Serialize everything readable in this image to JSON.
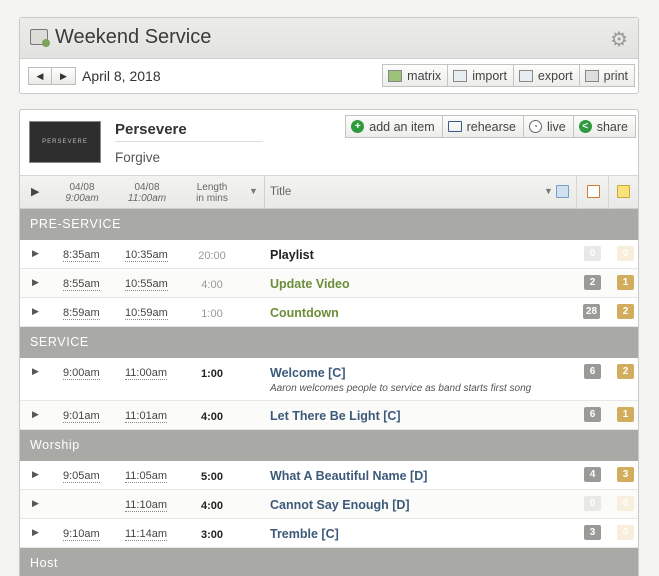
{
  "service": {
    "title": "Weekend Service",
    "date": "April 8, 2018",
    "tools": [
      "matrix",
      "import",
      "export",
      "print"
    ]
  },
  "plan": {
    "series_title": "Persevere",
    "series_subtitle": "Forgive",
    "image_text": "PERSEVERE",
    "actions": [
      "add an item",
      "rehearse",
      "live",
      "share"
    ]
  },
  "columns": {
    "time1_date": "04/08",
    "time1_time": "9:00am",
    "time2_date": "04/08",
    "time2_time": "11:00am",
    "length_l1": "Length",
    "length_l2": "in mins",
    "title": "Title"
  },
  "sections": [
    {
      "name": "PRE-SERVICE",
      "items": [
        {
          "t1": "8:35am",
          "t2": "10:35am",
          "len": "20:00",
          "len_bold": false,
          "title": "Playlist",
          "color": "black",
          "c1": "0",
          "c2": "0",
          "c1_dim": true,
          "c2_dim": true
        },
        {
          "t1": "8:55am",
          "t2": "10:55am",
          "len": "4:00",
          "len_bold": false,
          "title": "Update Video",
          "color": "green",
          "c1": "2",
          "c2": "1"
        },
        {
          "t1": "8:59am",
          "t2": "10:59am",
          "len": "1:00",
          "len_bold": false,
          "title": "Countdown",
          "color": "green",
          "c1": "28",
          "c2": "2"
        }
      ]
    },
    {
      "name": "SERVICE",
      "items": [
        {
          "t1": "9:00am",
          "t2": "11:00am",
          "len": "1:00",
          "len_bold": true,
          "title": "Welcome [C]",
          "note": "Aaron welcomes people to service as band starts first song",
          "color": "blue",
          "c1": "6",
          "c2": "2"
        },
        {
          "t1": "9:01am",
          "t2": "11:01am",
          "len": "4:00",
          "len_bold": true,
          "title": "Let There Be Light [C]",
          "color": "blue",
          "c1": "6",
          "c2": "1"
        }
      ]
    },
    {
      "name": "Worship",
      "items": [
        {
          "t1": "9:05am",
          "t2": "11:05am",
          "len": "5:00",
          "len_bold": true,
          "title": "What A Beautiful Name [D]",
          "color": "blue",
          "c1": "4",
          "c2": "3"
        },
        {
          "t1": "",
          "t2": "11:10am",
          "len": "4:00",
          "len_bold": true,
          "title": "Cannot Say Enough [D]",
          "color": "blue",
          "c1": "0",
          "c2": "0",
          "c1_dim": true,
          "c2_dim": true
        },
        {
          "t1": "9:10am",
          "t2": "11:14am",
          "len": "3:00",
          "len_bold": true,
          "title": "Tremble [C]",
          "color": "blue",
          "c1": "3",
          "c2": "0",
          "c2_dim": true
        }
      ]
    },
    {
      "name": "Host",
      "items": []
    }
  ]
}
